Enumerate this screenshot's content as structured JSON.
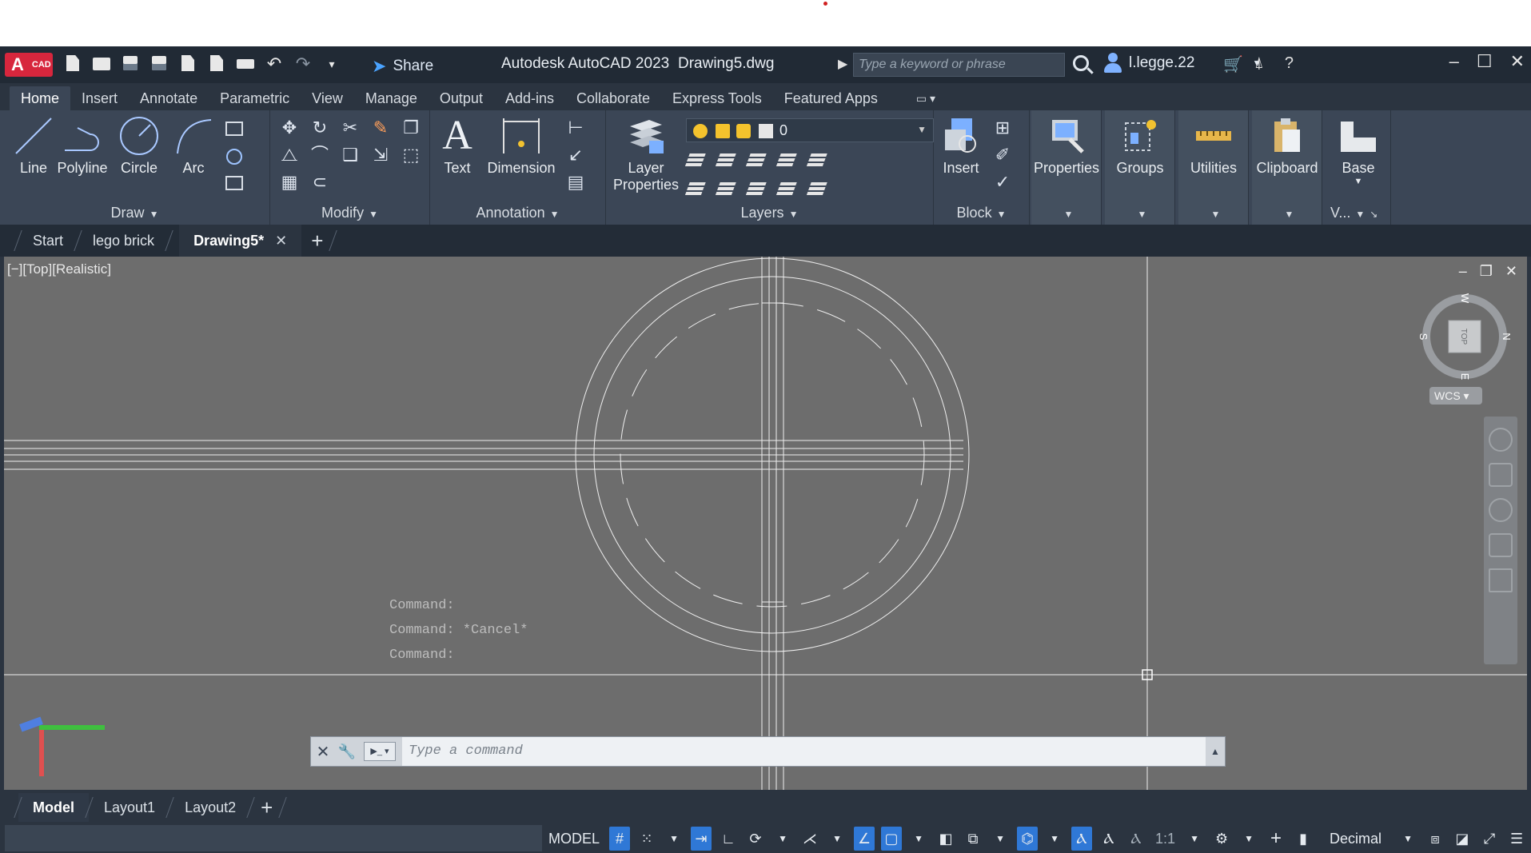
{
  "titlebar": {
    "logo_text": "A",
    "logo_sub": "CAD",
    "share_label": "Share",
    "app_title": "Autodesk AutoCAD 2023",
    "doc_name": "Drawing5.dwg",
    "search_placeholder": "Type a keyword or phrase",
    "user_name": "l.legge.22"
  },
  "ribbon_tabs": [
    "Home",
    "Insert",
    "Annotate",
    "Parametric",
    "View",
    "Manage",
    "Output",
    "Add-ins",
    "Collaborate",
    "Express Tools",
    "Featured Apps"
  ],
  "ribbon": {
    "draw": {
      "title": "Draw",
      "tools": [
        "Line",
        "Polyline",
        "Circle",
        "Arc"
      ]
    },
    "modify": {
      "title": "Modify"
    },
    "annotation": {
      "title": "Annotation",
      "tools": [
        "Text",
        "Dimension"
      ]
    },
    "layers": {
      "title": "Layers",
      "layer_props_line1": "Layer",
      "layer_props_line2": "Properties",
      "current_layer": "0"
    },
    "block": {
      "title": "Block",
      "tools": [
        "Insert"
      ]
    },
    "properties": {
      "label": "Properties"
    },
    "groups": {
      "label": "Groups"
    },
    "utilities": {
      "label": "Utilities"
    },
    "clipboard": {
      "label": "Clipboard"
    },
    "base": {
      "label": "Base",
      "view_title": "V..."
    }
  },
  "doc_tabs": {
    "start": "Start",
    "tab1": "lego brick",
    "tab2": "Drawing5*"
  },
  "viewport": {
    "label": "[−][Top][Realistic]",
    "viewcube_face": "TOP",
    "compass": {
      "n": "N",
      "s": "S",
      "e": "E",
      "w": "W"
    },
    "wcs": "WCS"
  },
  "command": {
    "history": [
      "Command:",
      "Command: *Cancel*",
      "Command:"
    ],
    "placeholder": "Type a command"
  },
  "layout_tabs": [
    "Model",
    "Layout1",
    "Layout2"
  ],
  "status": {
    "model": "MODEL",
    "scale": "1:1",
    "units": "Decimal"
  }
}
